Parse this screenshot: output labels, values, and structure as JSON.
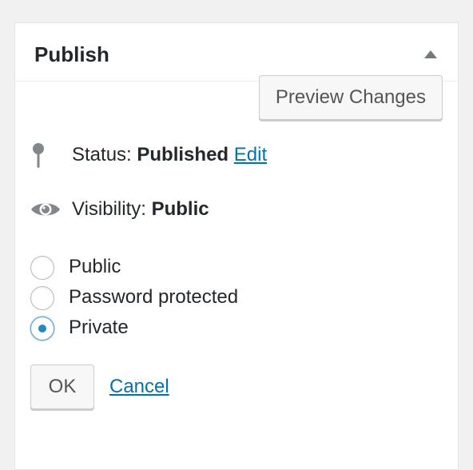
{
  "panel": {
    "title": "Publish",
    "toggle_icon": "triangle-up-icon"
  },
  "preview_button": {
    "label": "Preview Changes"
  },
  "status": {
    "icon": "pushpin-icon",
    "label": "Status:",
    "value": "Published",
    "edit_link": "Edit"
  },
  "visibility": {
    "icon": "eye-icon",
    "label": "Visibility:",
    "value": "Public",
    "options": [
      {
        "label": "Public",
        "checked": false
      },
      {
        "label": "Password protected",
        "checked": false
      },
      {
        "label": "Private",
        "checked": true
      }
    ]
  },
  "actions": {
    "ok_label": "OK",
    "cancel_label": "Cancel"
  },
  "colors": {
    "link": "#0073aa",
    "radio_selected": "#1e8cbe",
    "icon_gray": "#82878c"
  }
}
